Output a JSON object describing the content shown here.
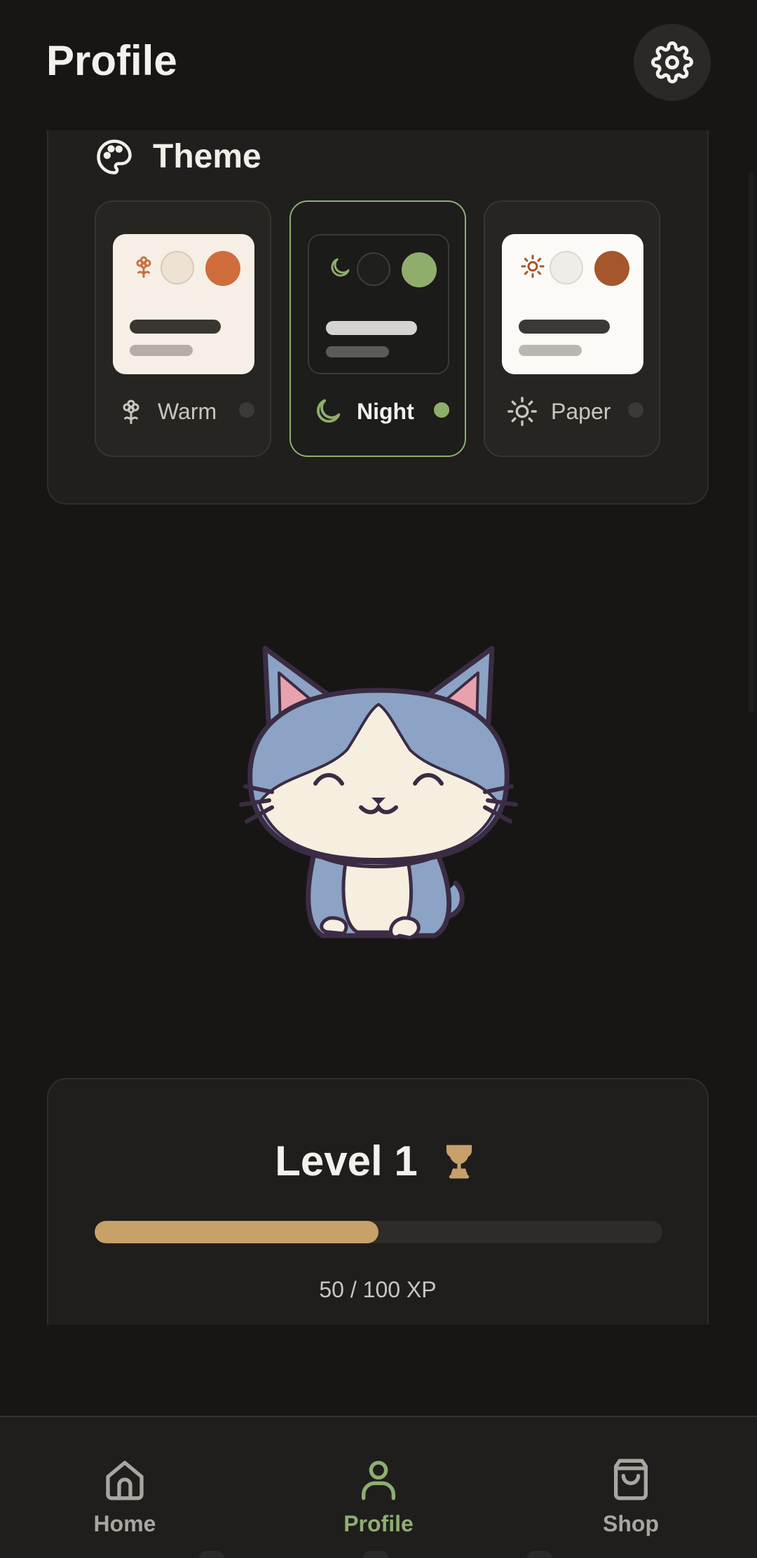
{
  "header": {
    "title": "Profile",
    "settings_icon": "gear-icon"
  },
  "theme": {
    "title": "Theme",
    "title_icon": "palette-icon",
    "options": [
      {
        "label": "Warm",
        "icon": "flower-icon",
        "selected": false,
        "colors": {
          "preview_bg": "#f7efe5",
          "dot_light": "#eee3d3",
          "dot_accent": "#cf6d3c",
          "bar_dark": "#3a3531",
          "bar_light": "#b6aea4",
          "icon": "#c8703f"
        }
      },
      {
        "label": "Night",
        "icon": "moon-icon",
        "selected": true,
        "colors": {
          "preview_bg": "#1b1b19",
          "dot_light": "#1f1f1d",
          "dot_accent": "#8fae6c",
          "bar_dark": "#d6d4d0",
          "bar_light": "#5c5b57",
          "icon": "#8fae6c"
        }
      },
      {
        "label": "Paper",
        "icon": "sun-icon",
        "selected": false,
        "colors": {
          "preview_bg": "#fbfaf7",
          "dot_light": "#efede8",
          "dot_accent": "#a5562a",
          "bar_dark": "#3b3936",
          "bar_light": "#bab7b2",
          "icon": "#a5562a"
        }
      }
    ]
  },
  "mascot": {
    "name": "cat-mascot"
  },
  "level": {
    "title": "Level 1",
    "icon": "trophy-icon",
    "xp_current": 50,
    "xp_max": 100,
    "xp_text": "50 / 100 XP",
    "xp_fraction": 0.5
  },
  "nav": {
    "items": [
      {
        "label": "Home",
        "icon": "home-icon",
        "active": false
      },
      {
        "label": "Profile",
        "icon": "user-icon",
        "active": true
      },
      {
        "label": "Shop",
        "icon": "shopping-bag-icon",
        "active": false
      }
    ]
  },
  "colors": {
    "accent_green": "#8fae72",
    "xp_gold": "#c8a06a",
    "background": "#171615",
    "card": "#201f1d"
  }
}
